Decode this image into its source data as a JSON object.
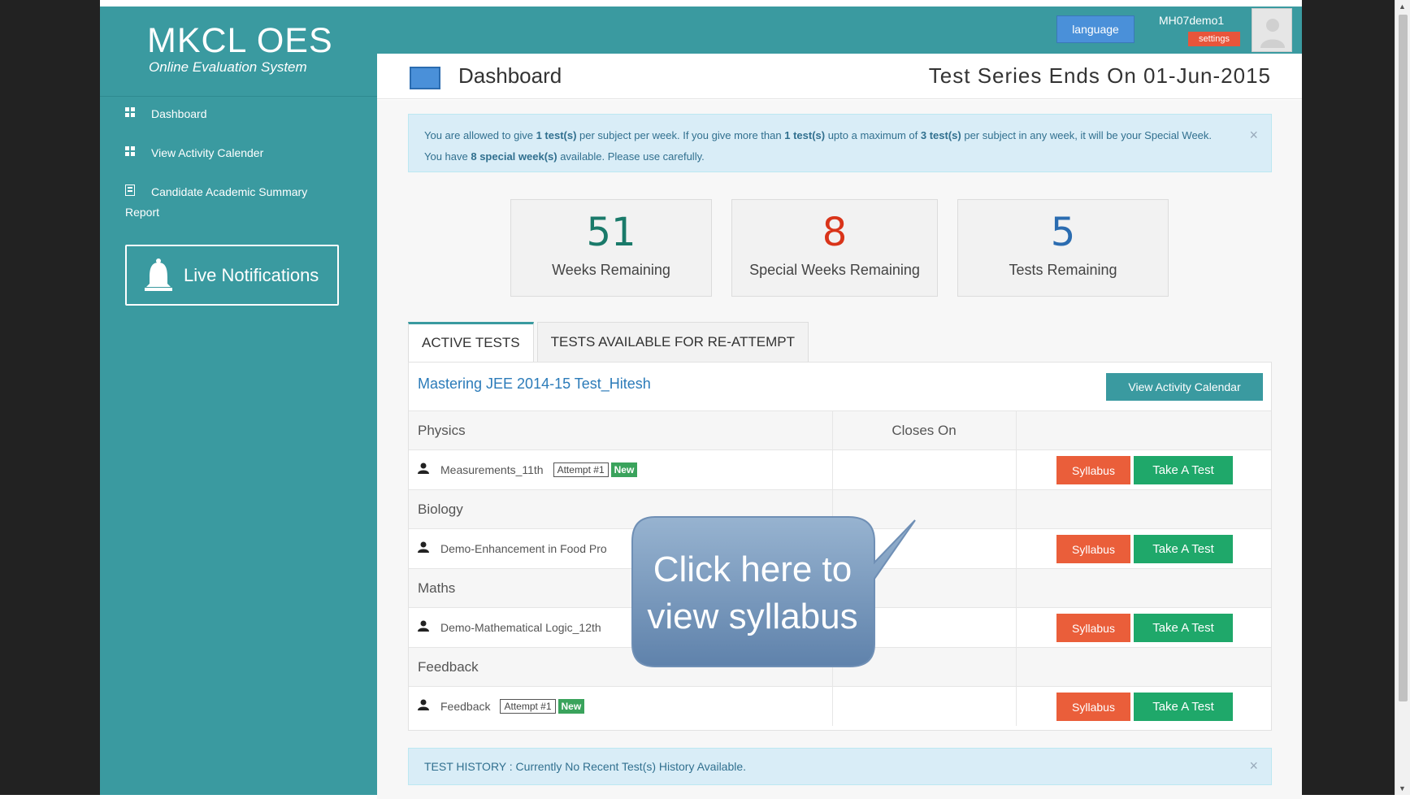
{
  "brand": {
    "title": "MKCL OES",
    "subtitle": "Online Evaluation System"
  },
  "sidebar": {
    "items": [
      {
        "label": "Dashboard",
        "icon": "grid-icon"
      },
      {
        "label": "View Activity Calender",
        "icon": "grid-icon"
      },
      {
        "label": "Candidate Academic Summary Report",
        "icon": "report-icon"
      }
    ],
    "live_notifications": "Live Notifications"
  },
  "topbar": {
    "language": "language",
    "username": "MH07demo1",
    "settings": "settings"
  },
  "header": {
    "title": "Dashboard",
    "series_end": "Test Series Ends On 01-Jun-2015"
  },
  "notice": {
    "p1": "You are allowed to give ",
    "b1": "1 test(s)",
    "p2": " per subject per week. If you give more than ",
    "b2": "1 test(s)",
    "p3": " upto a maximum of ",
    "b3": "3 test(s)",
    "p4": " per subject in any week, it will be your Special Week. You have ",
    "b4": "8 special week(s)",
    "p5": " available. Please use carefully."
  },
  "stats": [
    {
      "value": "51",
      "label": "Weeks Remaining",
      "color": "#1a7a6a"
    },
    {
      "value": "8",
      "label": "Special Weeks Remaining",
      "color": "#d9341a"
    },
    {
      "value": "5",
      "label": "Tests Remaining",
      "color": "#2b6cb0"
    }
  ],
  "tabs": [
    "ACTIVE TESTS",
    "TESTS AVAILABLE FOR RE-ATTEMPT"
  ],
  "panel": {
    "title": "Mastering JEE 2014-15 Test_Hitesh",
    "view_calendar": "View Activity Calendar",
    "closes_on_header": "Closes On",
    "groups": [
      {
        "subject": "Physics",
        "test": "Measurements_11th",
        "attempt": "Attempt #1",
        "badge": "New"
      },
      {
        "subject": "Biology",
        "test": "Demo-Enhancement in Food Pro",
        "attempt": "",
        "badge": ""
      },
      {
        "subject": "Maths",
        "test": "Demo-Mathematical Logic_12th",
        "attempt": "",
        "badge": ""
      },
      {
        "subject": "Feedback",
        "test": "Feedback",
        "attempt": "Attempt #1",
        "badge": "New"
      }
    ],
    "syllabus_label": "Syllabus",
    "take_test_label": "Take A Test"
  },
  "history": {
    "label": "TEST HISTORY",
    "text": " : Currently No Recent Test(s) History Available."
  },
  "callout": {
    "line1": "Click here to",
    "line2": "view syllabus"
  }
}
